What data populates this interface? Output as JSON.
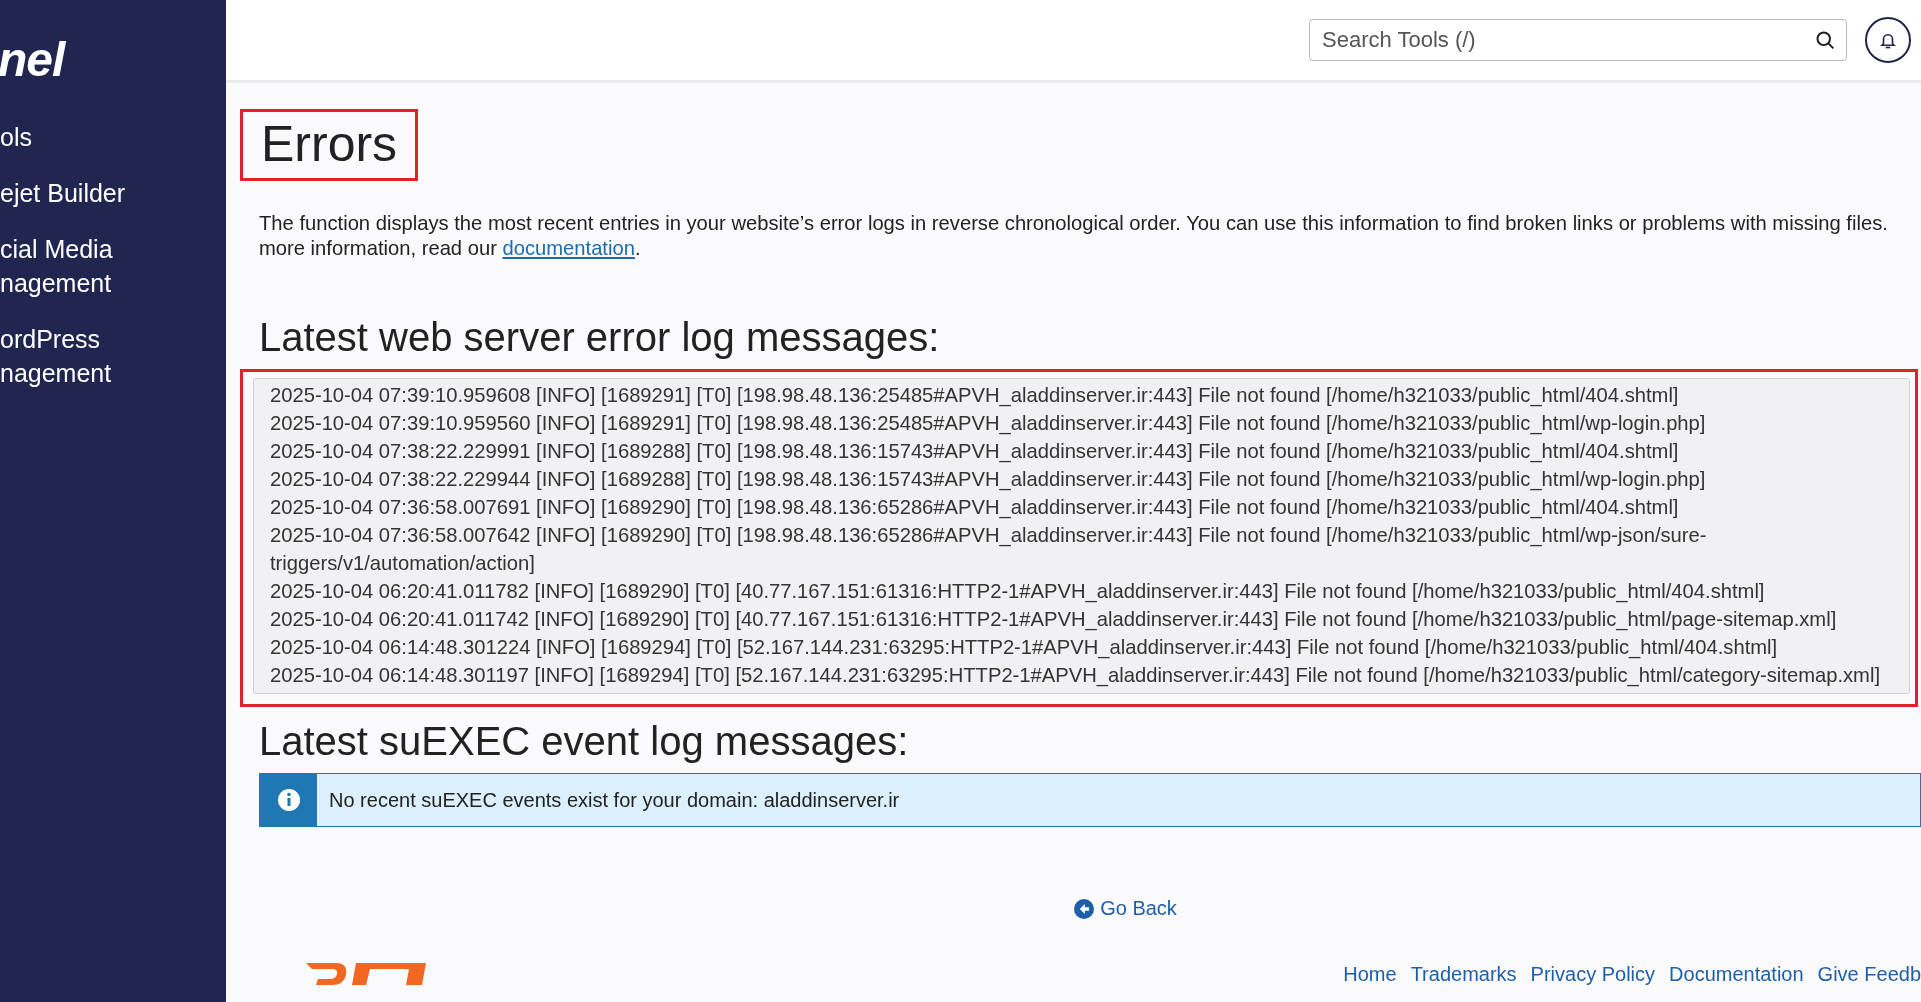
{
  "sidebar": {
    "logo": "nel",
    "items": [
      {
        "label": "ols"
      },
      {
        "label": "ejet Builder"
      },
      {
        "label": "cial Media\nnagement"
      },
      {
        "label": "ordPress\nnagement"
      }
    ]
  },
  "header": {
    "search": {
      "placeholder": "Search Tools (/)"
    }
  },
  "page": {
    "title": "Errors",
    "description_line_1": "The function displays the most recent entries in your website’s error logs in reverse chronological order. You can use this information to find broken links or problems with missing files.",
    "description_line_2": "more information, read our ",
    "description_link": "documentation",
    "description_end": "."
  },
  "error_log": {
    "heading": "Latest web server error log messages:",
    "entries": [
      "2025-10-04 07:39:10.959608 [INFO] [1689291] [T0] [198.98.48.136:25485#APVH_aladdinserver.ir:443] File not found [/home/h321033/public_html/404.shtml]",
      "2025-10-04 07:39:10.959560 [INFO] [1689291] [T0] [198.98.48.136:25485#APVH_aladdinserver.ir:443] File not found [/home/h321033/public_html/wp-login.php]",
      "2025-10-04 07:38:22.229991 [INFO] [1689288] [T0] [198.98.48.136:15743#APVH_aladdinserver.ir:443] File not found [/home/h321033/public_html/404.shtml]",
      "2025-10-04 07:38:22.229944 [INFO] [1689288] [T0] [198.98.48.136:15743#APVH_aladdinserver.ir:443] File not found [/home/h321033/public_html/wp-login.php]",
      "2025-10-04 07:36:58.007691 [INFO] [1689290] [T0] [198.98.48.136:65286#APVH_aladdinserver.ir:443] File not found [/home/h321033/public_html/404.shtml]",
      "2025-10-04 07:36:58.007642 [INFO] [1689290] [T0] [198.98.48.136:65286#APVH_aladdinserver.ir:443] File not found [/home/h321033/public_html/wp-json/sure-triggers/v1/automation/action]",
      "2025-10-04 06:20:41.011782 [INFO] [1689290] [T0] [40.77.167.151:61316:HTTP2-1#APVH_aladdinserver.ir:443] File not found [/home/h321033/public_html/404.shtml]",
      "2025-10-04 06:20:41.011742 [INFO] [1689290] [T0] [40.77.167.151:61316:HTTP2-1#APVH_aladdinserver.ir:443] File not found [/home/h321033/public_html/page-sitemap.xml]",
      "2025-10-04 06:14:48.301224 [INFO] [1689294] [T0] [52.167.144.231:63295:HTTP2-1#APVH_aladdinserver.ir:443] File not found [/home/h321033/public_html/404.shtml]",
      "2025-10-04 06:14:48.301197 [INFO] [1689294] [T0] [52.167.144.231:63295:HTTP2-1#APVH_aladdinserver.ir:443] File not found [/home/h321033/public_html/category-sitemap.xml]"
    ]
  },
  "suexec_log": {
    "heading": "Latest suEXEC event log messages:",
    "alert": "No recent suEXEC events exist for your domain: aladdinserver.ir"
  },
  "go_back": "Go Back",
  "footer": {
    "links": [
      "Home",
      "Trademarks",
      "Privacy Policy",
      "Documentation",
      "Give Feedb"
    ]
  }
}
